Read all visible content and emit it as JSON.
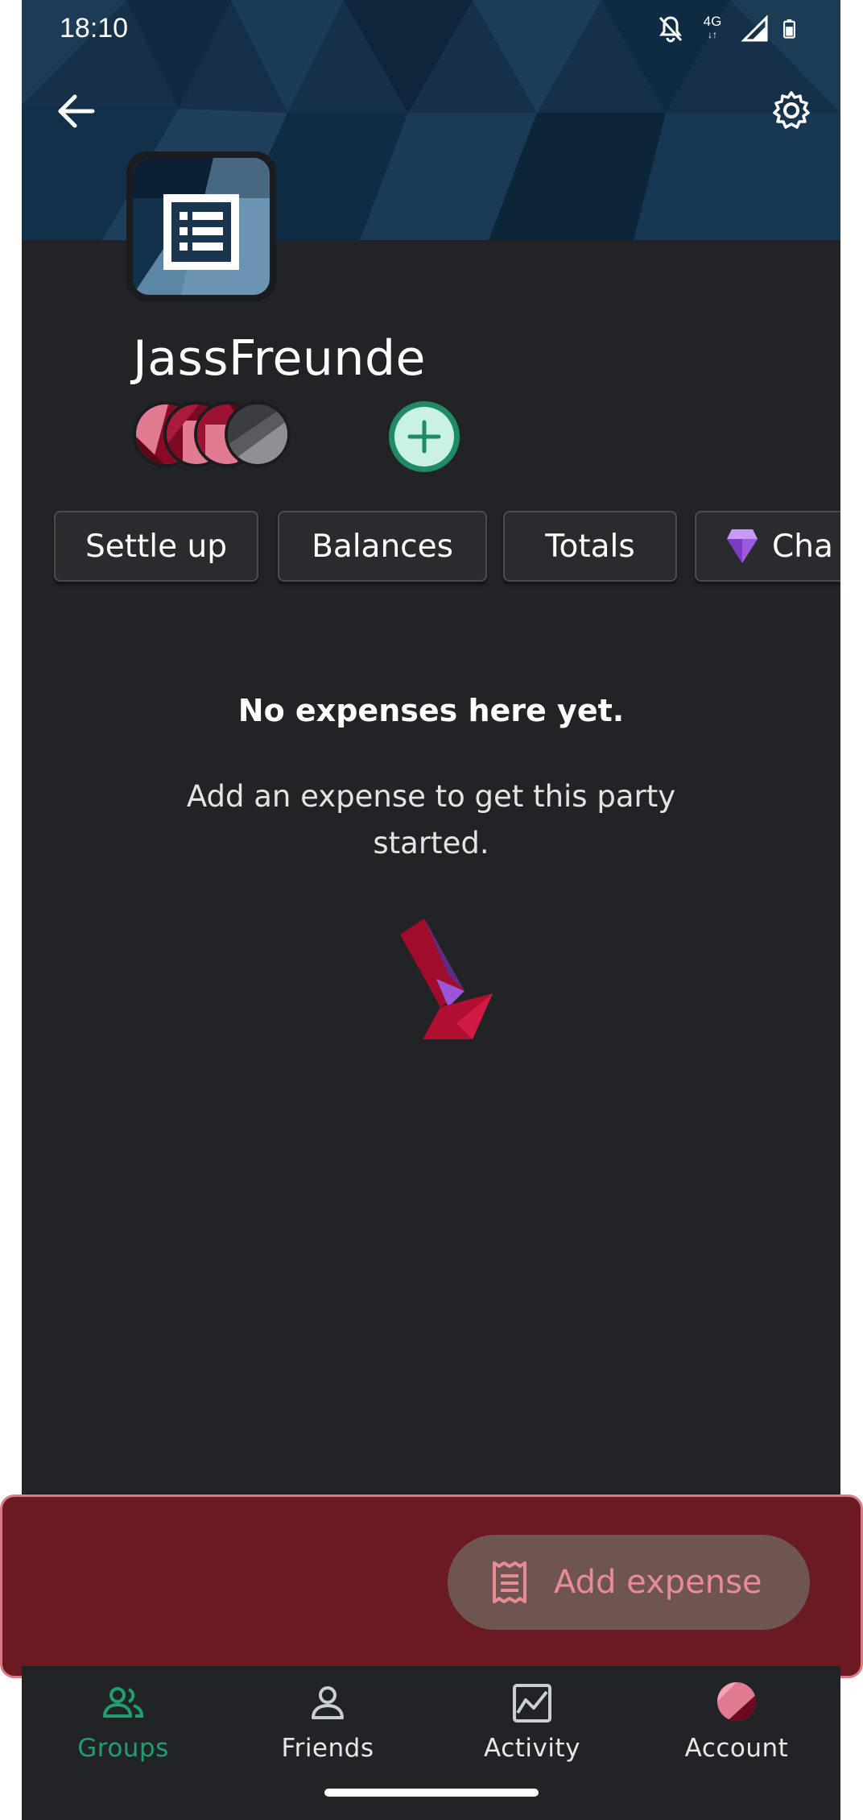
{
  "status_bar": {
    "time": "18:10",
    "network": "4G",
    "icons": [
      "notifications-off-icon",
      "network-4g-icon",
      "signal-icon",
      "battery-icon"
    ]
  },
  "header": {
    "back_icon": "arrow-left-icon",
    "settings_icon": "gear-icon"
  },
  "group": {
    "name": "JassFreunde",
    "avatar_icon": "receipt-list-icon",
    "add_member_icon": "plus-icon"
  },
  "chips": [
    {
      "label": "Settle up"
    },
    {
      "label": "Balances"
    },
    {
      "label": "Totals"
    },
    {
      "label": "Cha",
      "icon": "diamond-icon"
    }
  ],
  "empty_state": {
    "title": "No expenses here yet.",
    "description": "Add an expense to get this party started."
  },
  "fab": {
    "label": "Add expense",
    "icon": "receipt-icon"
  },
  "bottom_nav": [
    {
      "label": "Groups",
      "icon": "groups-icon",
      "active": true
    },
    {
      "label": "Friends",
      "icon": "person-icon",
      "active": false
    },
    {
      "label": "Activity",
      "icon": "activity-chart-icon",
      "active": false
    },
    {
      "label": "Account",
      "icon": "account-avatar-icon",
      "active": false
    }
  ],
  "colors": {
    "background": "#222326",
    "accent": "#1f9e73",
    "highlight": "#6c1a22",
    "fab_text": "#e88c93"
  }
}
